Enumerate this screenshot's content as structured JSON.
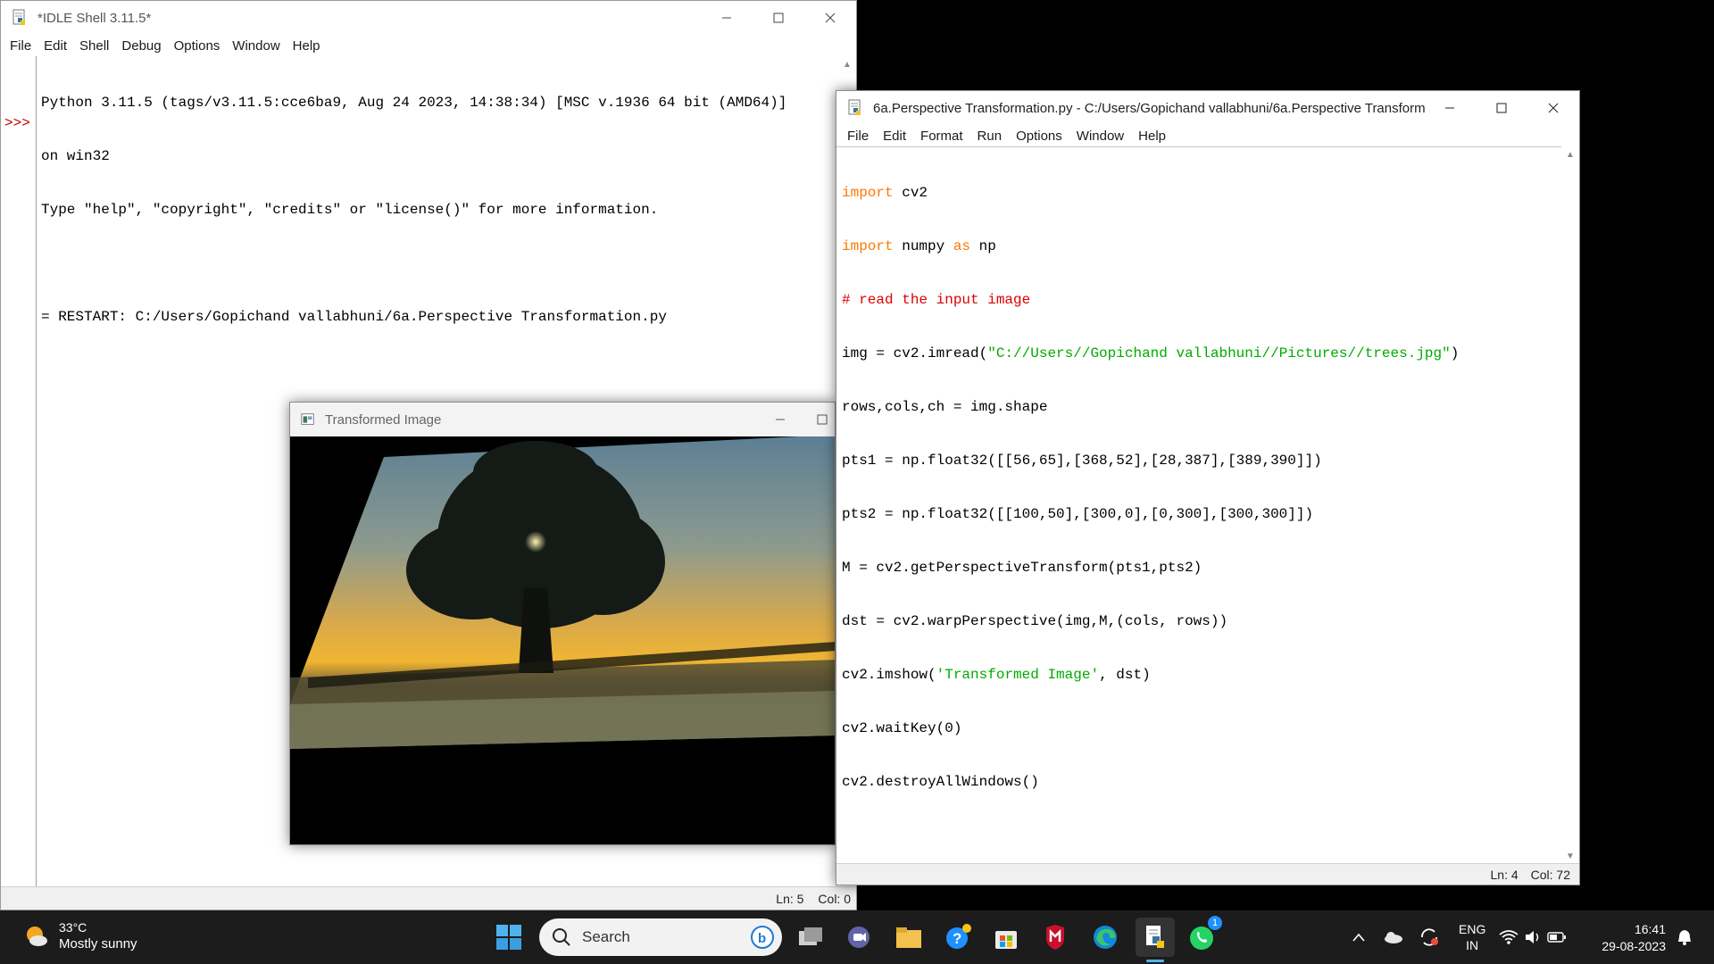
{
  "shell": {
    "title": "*IDLE Shell 3.11.5*",
    "menu": [
      "File",
      "Edit",
      "Shell",
      "Debug",
      "Options",
      "Window",
      "Help"
    ],
    "prompt": ">>>",
    "lines": [
      "Python 3.11.5 (tags/v3.11.5:cce6ba9, Aug 24 2023, 14:38:34) [MSC v.1936 64 bit (AMD64)]",
      "on win32",
      "Type \"help\", \"copyright\", \"credits\" or \"license()\" for more information.",
      "",
      "= RESTART: C:/Users/Gopichand vallabhuni/6a.Perspective Transformation.py"
    ],
    "status_ln": "Ln: 5",
    "status_col": "Col: 0"
  },
  "editor": {
    "title": "6a.Perspective Transformation.py - C:/Users/Gopichand vallabhuni/6a.Perspective Transform...",
    "menu": [
      "File",
      "Edit",
      "Format",
      "Run",
      "Options",
      "Window",
      "Help"
    ],
    "code": {
      "l1_kw": "import",
      "l1_rest": " cv2",
      "l2_kw": "import",
      "l2_mid": " numpy ",
      "l2_kw2": "as",
      "l2_rest": " np",
      "l3_comment": "# read the input image",
      "l4_pre": "img = cv2.imread(",
      "l4_str": "\"C://Users//Gopichand vallabhuni//Pictures//trees.jpg\"",
      "l4_post": ")",
      "l5": "rows,cols,ch = img.shape",
      "l6": "pts1 = np.float32([[56,65],[368,52],[28,387],[389,390]])",
      "l7": "pts2 = np.float32([[100,50],[300,0],[0,300],[300,300]])",
      "l8": "M = cv2.getPerspectiveTransform(pts1,pts2)",
      "l9": "dst = cv2.warpPerspective(img,M,(cols, rows))",
      "l10_pre": "cv2.imshow(",
      "l10_str": "'Transformed Image'",
      "l10_post": ", dst)",
      "l11": "cv2.waitKey(0)",
      "l12": "cv2.destroyAllWindows()"
    },
    "status_ln": "Ln: 4",
    "status_col": "Col: 72"
  },
  "image_window": {
    "title": "Transformed Image"
  },
  "taskbar": {
    "weather_temp": "33°C",
    "weather_cond": "Mostly sunny",
    "search_placeholder": "Search",
    "lang_top": "ENG",
    "lang_bottom": "IN",
    "time": "16:41",
    "date": "29-08-2023",
    "whatsapp_badge": "1"
  },
  "colors": {
    "keyword": "#ff7700",
    "comment": "#dd0000",
    "string": "#00aa00",
    "prompt": "#c00000",
    "taskbar": "#1c1c1c"
  }
}
